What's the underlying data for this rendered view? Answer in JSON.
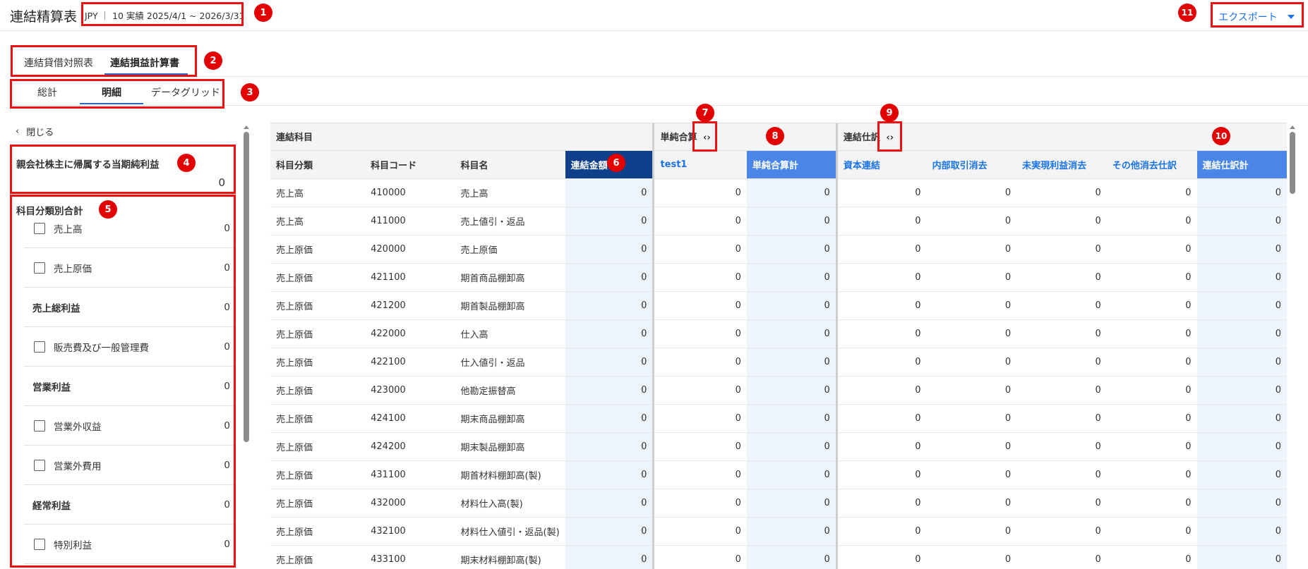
{
  "header": {
    "title": "連結精算表",
    "period": "JPY ｜ 10 実績 2025/4/1 ~ 2026/3/31",
    "export_label": "エクスポート"
  },
  "tabs": [
    "連結貸借対照表",
    "連結損益計算書"
  ],
  "subtabs": [
    "総計",
    "明細",
    "データグリッド"
  ],
  "sidebar": {
    "close_label": "閉じる",
    "net_income_label": "親会社株主に帰属する当期純利益",
    "net_income_value": "0",
    "category_total_label": "科目分類別合計",
    "items": [
      {
        "label": "売上高",
        "value": "0",
        "type": "check"
      },
      {
        "label": "売上原価",
        "value": "0",
        "type": "check"
      },
      {
        "label": "売上総利益",
        "value": "0",
        "type": "bold"
      },
      {
        "label": "販売費及び一般管理費",
        "value": "0",
        "type": "check"
      },
      {
        "label": "営業利益",
        "value": "0",
        "type": "bold"
      },
      {
        "label": "営業外収益",
        "value": "0",
        "type": "check"
      },
      {
        "label": "営業外費用",
        "value": "0",
        "type": "check"
      },
      {
        "label": "経常利益",
        "value": "0",
        "type": "bold"
      },
      {
        "label": "特別利益",
        "value": "0",
        "type": "check"
      }
    ]
  },
  "grid": {
    "groups": {
      "account": "連結科目",
      "simple": "単純合算",
      "elim": "連結仕訳"
    },
    "columns": [
      "科目分類",
      "科目コード",
      "科目名",
      "連結金額",
      "test1",
      "単純合算計",
      "資本連結",
      "内部取引消去",
      "未実現利益消去",
      "その他消去仕訳",
      "連結仕訳計"
    ],
    "rows": [
      [
        "売上高",
        "410000",
        "売上高"
      ],
      [
        "売上高",
        "411000",
        "売上値引・返品"
      ],
      [
        "売上原価",
        "420000",
        "売上原価"
      ],
      [
        "売上原価",
        "421100",
        "期首商品棚卸高"
      ],
      [
        "売上原価",
        "421200",
        "期首製品棚卸高"
      ],
      [
        "売上原価",
        "422000",
        "仕入高"
      ],
      [
        "売上原価",
        "422100",
        "仕入値引・返品"
      ],
      [
        "売上原価",
        "423000",
        "他勘定振替高"
      ],
      [
        "売上原価",
        "424100",
        "期末商品棚卸高"
      ],
      [
        "売上原価",
        "424200",
        "期末製品棚卸高"
      ],
      [
        "売上原価",
        "431100",
        "期首材料棚卸高(製)"
      ],
      [
        "売上原価",
        "432000",
        "材料仕入高(製)"
      ],
      [
        "売上原価",
        "432100",
        "材料仕入値引・返品(製)"
      ],
      [
        "売上原価",
        "433100",
        "期末材料棚卸高(製)"
      ]
    ],
    "cell_value": "0"
  },
  "markers": [
    "1",
    "2",
    "3",
    "4",
    "5",
    "6",
    "7",
    "8",
    "9",
    "10",
    "11"
  ],
  "colors": {
    "accent": "#1a73e8",
    "marker": "#e30000",
    "dark_header": "#0d3f8a",
    "mid_header": "#4a86e8"
  }
}
